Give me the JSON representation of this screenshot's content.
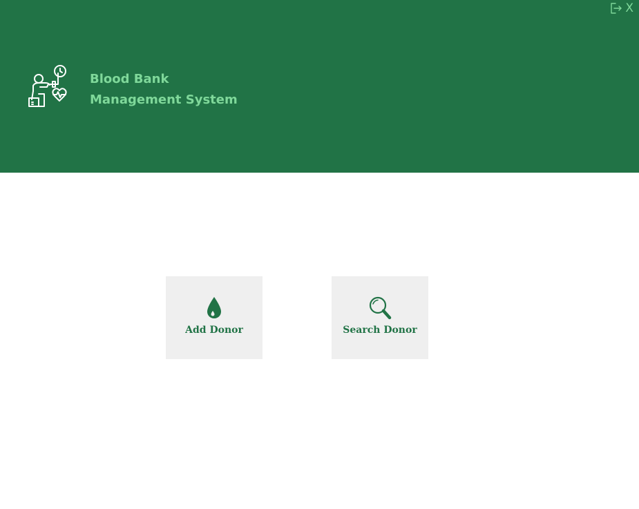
{
  "header": {
    "title_line1": "Blood Bank",
    "title_line2": "Management System",
    "logo_icon": "blood-donation-icon"
  },
  "window_controls": {
    "logout_icon": "logout-icon",
    "close_label": "X"
  },
  "tiles": [
    {
      "label": "Add Donor",
      "icon": "blood-drop-icon"
    },
    {
      "label": "Search Donor",
      "icon": "magnifier-icon"
    }
  ],
  "colors": {
    "header_bg": "#217346",
    "header_text": "#7fd89a",
    "tile_bg": "#efefef",
    "accent": "#217346"
  }
}
